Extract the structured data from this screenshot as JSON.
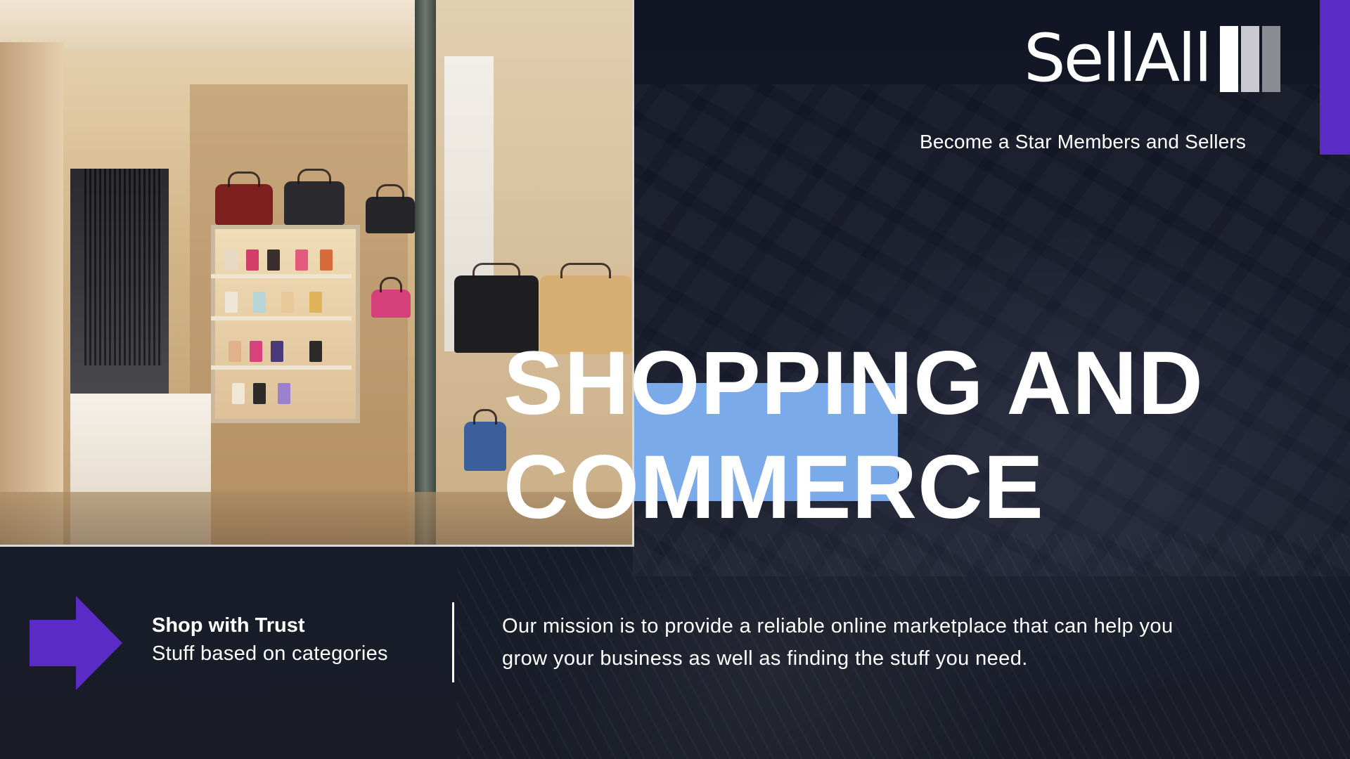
{
  "brand": {
    "logo_text": "SellAll",
    "tagline": "Become a Star Members and Sellers",
    "accent_color": "#5b2bc6",
    "highlight_color": "#7aaaea",
    "logo_bar_colors": [
      "#ffffff",
      "#c9c9cf",
      "#8c8c94"
    ]
  },
  "headline": {
    "line1": "SHOPPING AND",
    "line2": "COMMERCE"
  },
  "feature": {
    "icon": "arrow-right-icon",
    "title": "Shop with Trust",
    "subtitle": "Stuff based on categories"
  },
  "mission": {
    "text": "Our mission is to provide a reliable online marketplace that can help you grow your business as well as finding the stuff you need."
  }
}
